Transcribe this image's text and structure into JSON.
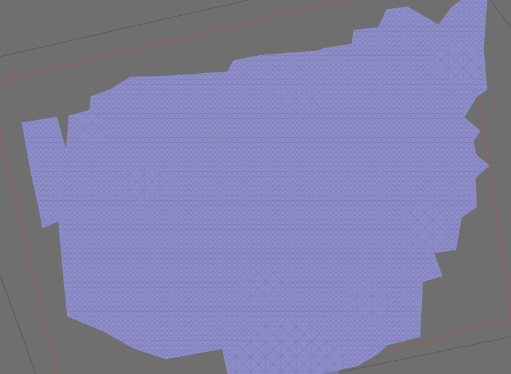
{
  "viewport": {
    "view": "top",
    "shading": "wireframe",
    "colors": {
      "background": "#6f6f6f",
      "grid_line": "#565656",
      "boundary_line": "#a85a5a",
      "mesh_fill": "#8f8fd0",
      "mesh_wire": "#7a7aa8"
    }
  },
  "mesh": {
    "object": "reconstructed-terrain-mesh",
    "display": "triangulated-wireframe"
  }
}
